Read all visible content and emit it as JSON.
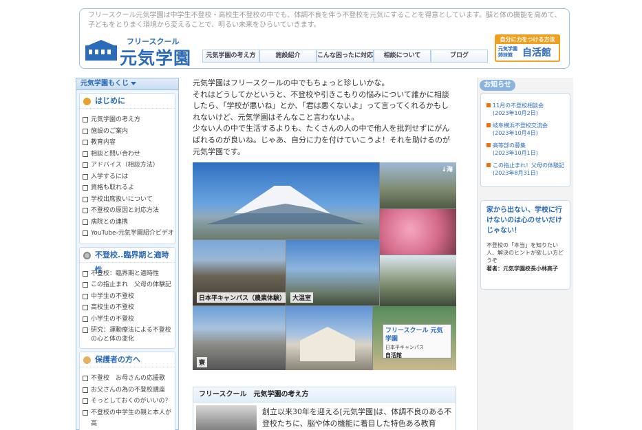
{
  "header": {
    "description": "フリースクール元気学園は中学生不登校・高校生不登校の中でも、体調不良を伴う不登校を元気にすることを得意としています。脳と体の機能を高めて、子どもをとりまく環境から変えることで、明るい未来をひらいていきます。",
    "logo_sub": "フリースクール",
    "logo_main": "元気学園",
    "nav": [
      "元気学園の考え方",
      "施設紹介",
      "こんな困ったに対応",
      "相談について",
      "ブログ"
    ],
    "banner": {
      "top": "自分に力をつける方法",
      "left": "元気学園\n姉妹館",
      "right": "自活館"
    }
  },
  "sidebar": {
    "heading": "元気学園もくじ",
    "sections": [
      {
        "title": "はじめに",
        "icon": "badge-icon",
        "items": [
          "元気学園の考え方",
          "施設のご案内",
          "教育内容",
          "相談と問い合わせ",
          "アドバイス（相談方法）",
          "入学するには",
          "資格も取れるよ",
          "学校出席扱いについて",
          "不登校の原因と対応方法",
          "病院との連携",
          "YouTube-元気学園紹介ビデオ"
        ]
      },
      {
        "title": "不登校..臨界期と適時性",
        "icon": "gear-icon",
        "items": [
          "不登校：臨界期と適時性",
          "この指止まれ　父母の体験記",
          "中学生の不登校",
          "高校生の不登校",
          "小学生の不登校",
          "研究：運動療法による不登校の心と体の変化"
        ]
      },
      {
        "title": "保護者の方へ",
        "icon": "lamp-icon",
        "items": [
          "不登校　お母さんの応援歌",
          "お父さんの為の不登校講座",
          "そっとしておくのがいいの？",
          "不登校の中学生の親と本人が高"
        ]
      }
    ]
  },
  "main": {
    "intro": "元気学園はフリースクールの中でもちょっと珍しいかな。\nそれはどうしてかというと、不登校や引きこもりの悩みについて誰かに相談したら、「学校が悪いね」とか、「君は悪くないよ」って言ってくれるかもしれないけど、元気学園はそんなこと言わないよ。\n少ない人の中で生活するよりも、たくさんの人の中で他人を批判せずにがんばれるのが良いね。じゃあ、自分に力を付けていこうよ！それを助けるのが元気学園です。",
    "photo_labels": {
      "sea": "↓海",
      "campus": "日本平キャンパス（農業体験）",
      "hall": "大温室",
      "dorm": "寮",
      "sign_top": "フリースクール 元気学園",
      "sign_sub": "日本平キャンパス",
      "sign_name": "自活館"
    },
    "section_title": "フリースクール　元気学園の考え方",
    "section_text": "創立以来30年を迎える[元気学園]は、体調不良のある不登校たちに、脳や体の機能に着目した特色ある教育"
  },
  "right": {
    "news_tag": "お知らせ",
    "news": [
      {
        "title": "11月の不登校相談会",
        "date": "(2023年10月2日)"
      },
      {
        "title": "岐阜横浜不登校交流会",
        "date": "(2023年10月4日)"
      },
      {
        "title": "高等部の募集",
        "date": "(2023年10月1日)"
      },
      {
        "title": "この指止まれ！父母の体験記",
        "date": "(2023年8月31日)"
      }
    ],
    "book_title": "家から出ない、学校に行けないのは心のせいだけじゃない！",
    "book_desc": "不登校の「本当」を知りたい人、解決のヒントが欲しい方どうぞ",
    "book_author": "著者：元気学園校長小林高子"
  }
}
